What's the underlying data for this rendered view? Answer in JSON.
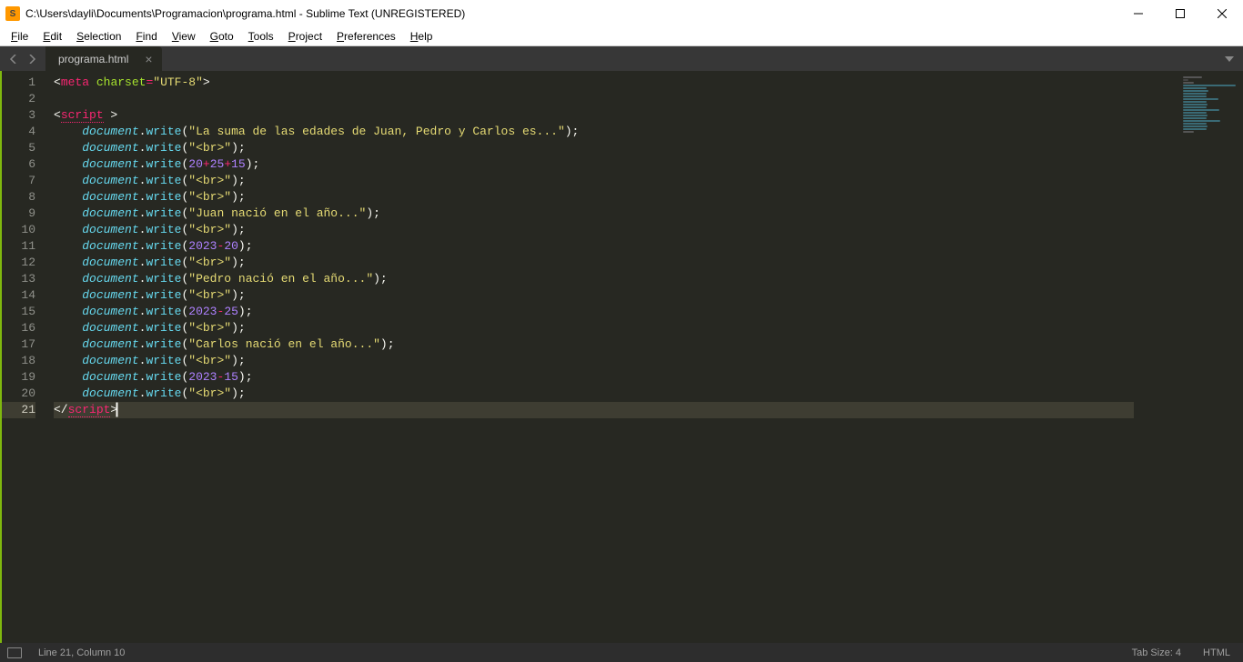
{
  "window": {
    "title": "C:\\Users\\dayli\\Documents\\Programacion\\programa.html - Sublime Text (UNREGISTERED)",
    "app_icon_letter": "S"
  },
  "menubar": {
    "items": [
      "File",
      "Edit",
      "Selection",
      "Find",
      "View",
      "Goto",
      "Tools",
      "Project",
      "Preferences",
      "Help"
    ]
  },
  "tabs": [
    {
      "label": "programa.html",
      "active": true
    }
  ],
  "editor": {
    "line_count": 21,
    "active_line": 21,
    "cursor_after_char": 9,
    "lines": [
      {
        "n": 1,
        "tokens": [
          [
            "punct",
            "<"
          ],
          [
            "tag",
            "meta"
          ],
          [
            "punct",
            " "
          ],
          [
            "attr",
            "charset"
          ],
          [
            "op",
            "="
          ],
          [
            "str",
            "\"UTF-8\""
          ],
          [
            "punct",
            ">"
          ]
        ]
      },
      {
        "n": 2,
        "tokens": []
      },
      {
        "n": 3,
        "tokens": [
          [
            "punct",
            "<"
          ],
          [
            "tag-dotted",
            "script"
          ],
          [
            "punct",
            " >"
          ]
        ]
      },
      {
        "n": 4,
        "indent": 1,
        "tokens": [
          [
            "ident",
            "document"
          ],
          [
            "punct",
            "."
          ],
          [
            "method",
            "write"
          ],
          [
            "punct",
            "("
          ],
          [
            "str",
            "\"La suma de las edades de Juan, Pedro y Carlos es...\""
          ],
          [
            "punct",
            ");"
          ]
        ]
      },
      {
        "n": 5,
        "indent": 1,
        "tokens": [
          [
            "ident",
            "document"
          ],
          [
            "punct",
            "."
          ],
          [
            "method",
            "write"
          ],
          [
            "punct",
            "("
          ],
          [
            "str",
            "\"<br>\""
          ],
          [
            "punct",
            ");"
          ]
        ]
      },
      {
        "n": 6,
        "indent": 1,
        "tokens": [
          [
            "ident",
            "document"
          ],
          [
            "punct",
            "."
          ],
          [
            "method",
            "write"
          ],
          [
            "punct",
            "("
          ],
          [
            "num",
            "20"
          ],
          [
            "op",
            "+"
          ],
          [
            "num",
            "25"
          ],
          [
            "op",
            "+"
          ],
          [
            "num",
            "15"
          ],
          [
            "punct",
            ");"
          ]
        ]
      },
      {
        "n": 7,
        "indent": 1,
        "tokens": [
          [
            "ident",
            "document"
          ],
          [
            "punct",
            "."
          ],
          [
            "method",
            "write"
          ],
          [
            "punct",
            "("
          ],
          [
            "str",
            "\"<br>\""
          ],
          [
            "punct",
            ");"
          ]
        ]
      },
      {
        "n": 8,
        "indent": 1,
        "tokens": [
          [
            "ident",
            "document"
          ],
          [
            "punct",
            "."
          ],
          [
            "method",
            "write"
          ],
          [
            "punct",
            "("
          ],
          [
            "str",
            "\"<br>\""
          ],
          [
            "punct",
            ");"
          ]
        ]
      },
      {
        "n": 9,
        "indent": 1,
        "tokens": [
          [
            "ident",
            "document"
          ],
          [
            "punct",
            "."
          ],
          [
            "method",
            "write"
          ],
          [
            "punct",
            "("
          ],
          [
            "str",
            "\"Juan nació en el año...\""
          ],
          [
            "punct",
            ");"
          ]
        ]
      },
      {
        "n": 10,
        "indent": 1,
        "tokens": [
          [
            "ident",
            "document"
          ],
          [
            "punct",
            "."
          ],
          [
            "method",
            "write"
          ],
          [
            "punct",
            "("
          ],
          [
            "str",
            "\"<br>\""
          ],
          [
            "punct",
            ");"
          ]
        ]
      },
      {
        "n": 11,
        "indent": 1,
        "tokens": [
          [
            "ident",
            "document"
          ],
          [
            "punct",
            "."
          ],
          [
            "method",
            "write"
          ],
          [
            "punct",
            "("
          ],
          [
            "num",
            "2023"
          ],
          [
            "op",
            "-"
          ],
          [
            "num",
            "20"
          ],
          [
            "punct",
            ");"
          ]
        ]
      },
      {
        "n": 12,
        "indent": 1,
        "tokens": [
          [
            "ident",
            "document"
          ],
          [
            "punct",
            "."
          ],
          [
            "method",
            "write"
          ],
          [
            "punct",
            "("
          ],
          [
            "str",
            "\"<br>\""
          ],
          [
            "punct",
            ");"
          ]
        ]
      },
      {
        "n": 13,
        "indent": 1,
        "tokens": [
          [
            "ident",
            "document"
          ],
          [
            "punct",
            "."
          ],
          [
            "method",
            "write"
          ],
          [
            "punct",
            "("
          ],
          [
            "str",
            "\"Pedro nació en el año...\""
          ],
          [
            "punct",
            ");"
          ]
        ]
      },
      {
        "n": 14,
        "indent": 1,
        "tokens": [
          [
            "ident",
            "document"
          ],
          [
            "punct",
            "."
          ],
          [
            "method",
            "write"
          ],
          [
            "punct",
            "("
          ],
          [
            "str",
            "\"<br>\""
          ],
          [
            "punct",
            ");"
          ]
        ]
      },
      {
        "n": 15,
        "indent": 1,
        "tokens": [
          [
            "ident",
            "document"
          ],
          [
            "punct",
            "."
          ],
          [
            "method",
            "write"
          ],
          [
            "punct",
            "("
          ],
          [
            "num",
            "2023"
          ],
          [
            "op",
            "-"
          ],
          [
            "num",
            "25"
          ],
          [
            "punct",
            ");"
          ]
        ]
      },
      {
        "n": 16,
        "indent": 1,
        "tokens": [
          [
            "ident",
            "document"
          ],
          [
            "punct",
            "."
          ],
          [
            "method",
            "write"
          ],
          [
            "punct",
            "("
          ],
          [
            "str",
            "\"<br>\""
          ],
          [
            "punct",
            ");"
          ]
        ]
      },
      {
        "n": 17,
        "indent": 1,
        "tokens": [
          [
            "ident",
            "document"
          ],
          [
            "punct",
            "."
          ],
          [
            "method",
            "write"
          ],
          [
            "punct",
            "("
          ],
          [
            "str",
            "\"Carlos nació en el año...\""
          ],
          [
            "punct",
            ");"
          ]
        ]
      },
      {
        "n": 18,
        "indent": 1,
        "tokens": [
          [
            "ident",
            "document"
          ],
          [
            "punct",
            "."
          ],
          [
            "method",
            "write"
          ],
          [
            "punct",
            "("
          ],
          [
            "str",
            "\"<br>\""
          ],
          [
            "punct",
            ");"
          ]
        ]
      },
      {
        "n": 19,
        "indent": 1,
        "tokens": [
          [
            "ident",
            "document"
          ],
          [
            "punct",
            "."
          ],
          [
            "method",
            "write"
          ],
          [
            "punct",
            "("
          ],
          [
            "num",
            "2023"
          ],
          [
            "op",
            "-"
          ],
          [
            "num",
            "15"
          ],
          [
            "punct",
            ");"
          ]
        ]
      },
      {
        "n": 20,
        "indent": 1,
        "tokens": [
          [
            "ident",
            "document"
          ],
          [
            "punct",
            "."
          ],
          [
            "method",
            "write"
          ],
          [
            "punct",
            "("
          ],
          [
            "str",
            "\"<br>\""
          ],
          [
            "punct",
            ");"
          ]
        ]
      },
      {
        "n": 21,
        "tokens": [
          [
            "punct",
            "</"
          ],
          [
            "tag-dotted",
            "script"
          ],
          [
            "punct",
            ">"
          ]
        ],
        "cursor": true
      }
    ]
  },
  "statusbar": {
    "position": "Line 21, Column 10",
    "tab_size": "Tab Size: 4",
    "syntax": "HTML"
  },
  "colors": {
    "bg": "#272822",
    "fg": "#f8f8f2",
    "tag": "#f92672",
    "attr": "#a6e22e",
    "str": "#e6db74",
    "num": "#ae81ff",
    "ident": "#66d9ef"
  }
}
